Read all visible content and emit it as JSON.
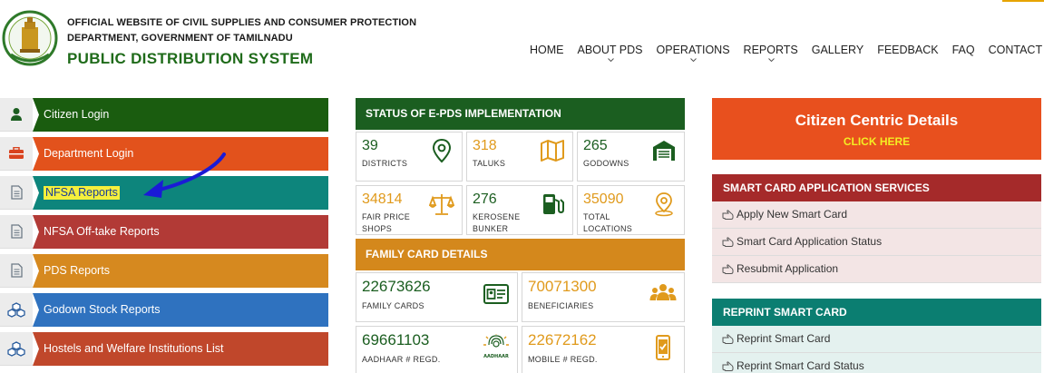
{
  "header": {
    "dept_line1": "OFFICIAL WEBSITE OF CIVIL SUPPLIES AND CONSUMER PROTECTION",
    "dept_line2": "DEPARTMENT, GOVERNMENT OF TAMILNADU",
    "site_title": "PUBLIC DISTRIBUTION SYSTEM",
    "emblem_icon": "tamilnadu-emblem-icon"
  },
  "nav": {
    "items": [
      {
        "label": "HOME",
        "has_dropdown": false
      },
      {
        "label": "ABOUT PDS",
        "has_dropdown": true
      },
      {
        "label": "OPERATIONS",
        "has_dropdown": true
      },
      {
        "label": "REPORTS",
        "has_dropdown": true
      },
      {
        "label": "GALLERY",
        "has_dropdown": false
      },
      {
        "label": "FEEDBACK",
        "has_dropdown": false
      },
      {
        "label": "FAQ",
        "has_dropdown": false
      },
      {
        "label": "CONTACT US",
        "has_dropdown": false
      }
    ]
  },
  "menu": {
    "items": [
      {
        "label": "Citizen Login",
        "color": "#1a5c0f",
        "icon": "user-icon"
      },
      {
        "label": "Department Login",
        "color": "#e2521c",
        "icon": "briefcase-icon"
      },
      {
        "label": "NFSA Reports",
        "color": "#0d857c",
        "icon": "document-icon"
      },
      {
        "label": "NFSA Off-take Reports",
        "color": "#b23a36",
        "icon": "document-icon"
      },
      {
        "label": "PDS Reports",
        "color": "#d6891f",
        "icon": "document-icon"
      },
      {
        "label": "Godown Stock Reports",
        "color": "#2f72bf",
        "icon": "cubes-icon"
      },
      {
        "label": "Hostels and Welfare Institutions List",
        "color": "#c0472b",
        "icon": "cubes-icon"
      }
    ]
  },
  "epds": {
    "heading": "STATUS OF E-PDS IMPLEMENTATION",
    "stats": [
      {
        "value": "39",
        "label": "DISTRICTS",
        "icon": "map-pin-icon",
        "accent": "green"
      },
      {
        "value": "318",
        "label": "TALUKS",
        "icon": "map-icon",
        "accent": "orange"
      },
      {
        "value": "265",
        "label": "GODOWNS",
        "icon": "warehouse-icon",
        "accent": "green"
      },
      {
        "value": "34814",
        "label": "FAIR PRICE SHOPS",
        "icon": "balance-scale-icon",
        "accent": "orange"
      },
      {
        "value": "276",
        "label": "KEROSENE BUNKER",
        "icon": "fuel-pump-icon",
        "accent": "green"
      },
      {
        "value": "35090",
        "label": "TOTAL LOCATIONS",
        "icon": "location-icon",
        "accent": "orange"
      }
    ]
  },
  "family": {
    "heading": "FAMILY CARD DETAILS",
    "stats": [
      {
        "value": "22673626",
        "label": "FAMILY CARDS",
        "icon": "id-card-icon",
        "accent": "green"
      },
      {
        "value": "70071300",
        "label": "BENEFICIARIES",
        "icon": "users-icon",
        "accent": "orange"
      },
      {
        "value": "69661103",
        "label": "AADHAAR # REGD.",
        "icon": "aadhaar-icon",
        "accent": "green"
      },
      {
        "value": "22672162",
        "label": "MOBILE # REGD.",
        "icon": "mobile-icon",
        "accent": "orange"
      }
    ]
  },
  "citizen_centric": {
    "title": "Citizen Centric Details",
    "cta": "CLICK HERE"
  },
  "smart_card_services": {
    "heading": "SMART CARD APPLICATION SERVICES",
    "items": [
      "Apply New Smart Card",
      "Smart Card Application Status",
      "Resubmit Application"
    ]
  },
  "reprint": {
    "heading": "REPRINT SMART CARD",
    "items": [
      "Reprint Smart Card",
      "Reprint Smart Card Status"
    ]
  },
  "colors": {
    "green": "#1b5e20",
    "orange": "#e09a1c",
    "annotation_arrow": "#1a1ad6",
    "highlight": "#f5ef3c"
  }
}
